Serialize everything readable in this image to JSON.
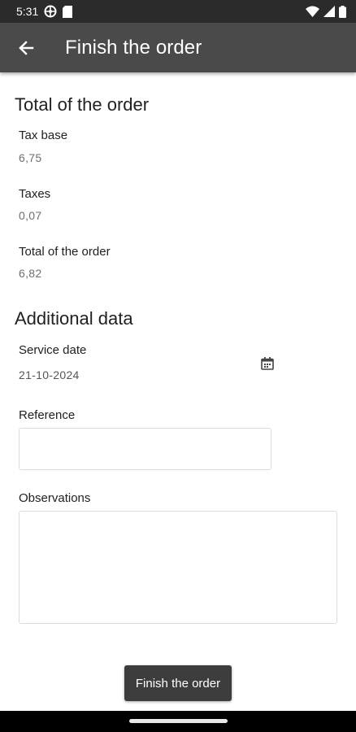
{
  "status_bar": {
    "time": "5:31",
    "icons": [
      "vpn-icon",
      "sd-card-icon",
      "wifi-icon",
      "signal-icon",
      "battery-icon"
    ]
  },
  "app_bar": {
    "back_icon": "arrow-back-icon",
    "title": "Finish the order"
  },
  "totals": {
    "section_title": "Total of the order",
    "tax_base_label": "Tax base",
    "tax_base_value": "6,75",
    "taxes_label": "Taxes",
    "taxes_value": "0,07",
    "total_label": "Total of the order",
    "total_value": "6,82"
  },
  "additional": {
    "section_title": "Additional data",
    "service_date_label": "Service date",
    "service_date_value": "21-10-2024",
    "calendar_icon": "calendar-icon",
    "reference_label": "Reference",
    "reference_value": "",
    "observations_label": "Observations",
    "observations_value": ""
  },
  "actions": {
    "finish_label": "Finish the order"
  },
  "colors": {
    "status_bar_bg": "#2b2b2b",
    "app_bar_bg": "#4a4a4a",
    "button_bg": "#3d3d3d",
    "value_text": "#6f6f6f"
  }
}
